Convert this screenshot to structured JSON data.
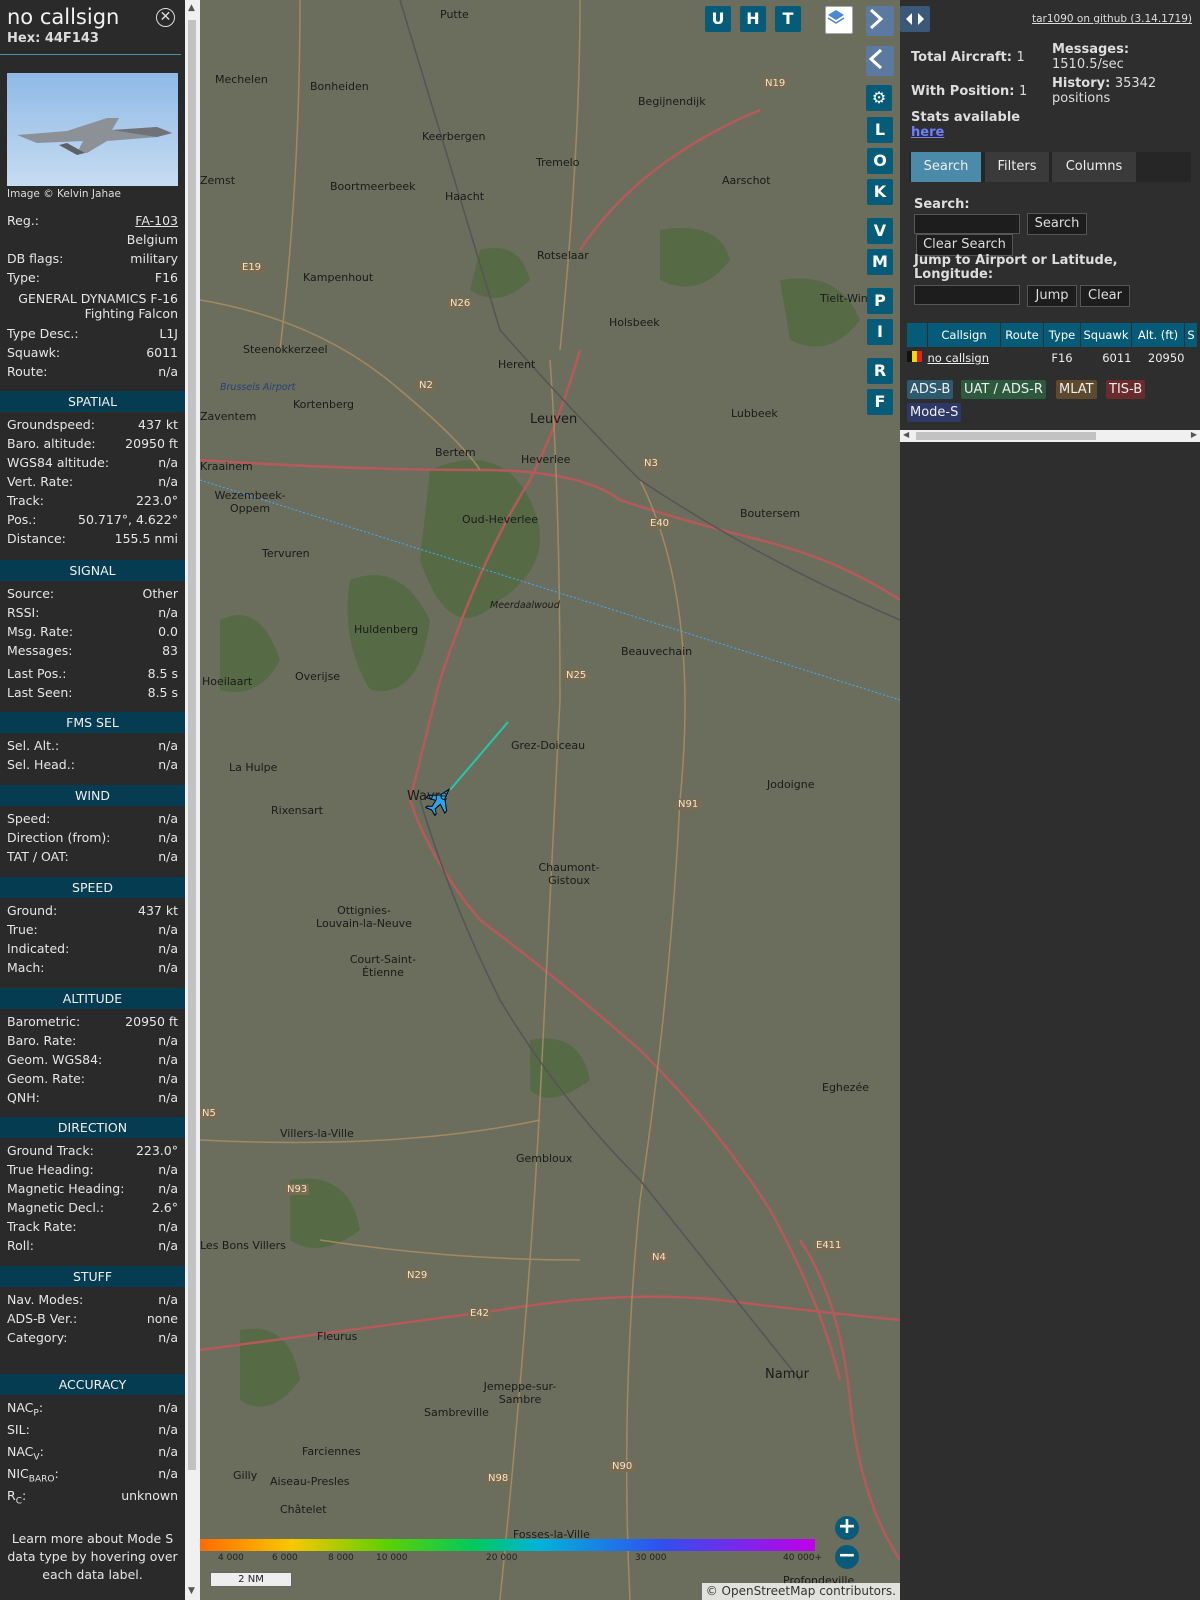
{
  "info": {
    "callsign": "no callsign",
    "hex_label": "Hex:",
    "hex": "44F143",
    "image_credit": "Image © Kelvin Jahae",
    "reg_label": "Reg.:",
    "reg": "FA-103",
    "country": "Belgium",
    "dbflags_label": "DB flags:",
    "dbflags": "military",
    "type_label": "Type:",
    "type": "F16",
    "type_name_1": "GENERAL DYNAMICS F-16",
    "type_name_2": "Fighting Falcon",
    "typedesc_label": "Type Desc.:",
    "typedesc": "L1J",
    "squawk_label": "Squawk:",
    "squawk": "6011",
    "route_label": "Route:",
    "route": "n/a",
    "spatial_title": "SPATIAL",
    "spatial": [
      {
        "k": "Groundspeed:",
        "v": "437 kt"
      },
      {
        "k": "Baro. altitude:",
        "v": "20950 ft"
      },
      {
        "k": "WGS84 altitude:",
        "v": "n/a"
      },
      {
        "k": "Vert. Rate:",
        "v": "n/a"
      },
      {
        "k": "Track:",
        "v": "223.0°"
      },
      {
        "k": "Pos.:",
        "v": "50.717°, 4.622°"
      },
      {
        "k": "Distance:",
        "v": "155.5 nmi"
      }
    ],
    "signal_title": "SIGNAL",
    "signal": [
      {
        "k": "Source:",
        "v": "Other"
      },
      {
        "k": "RSSI:",
        "v": "n/a"
      },
      {
        "k": "Msg. Rate:",
        "v": "0.0"
      },
      {
        "k": "Messages:",
        "v": "83"
      },
      {
        "k": "Last Pos.:",
        "v": "8.5 s"
      },
      {
        "k": "Last Seen:",
        "v": "8.5 s"
      }
    ],
    "fms_title": "FMS SEL",
    "fms": [
      {
        "k": "Sel. Alt.:",
        "v": "n/a"
      },
      {
        "k": "Sel. Head.:",
        "v": "n/a"
      }
    ],
    "wind_title": "WIND",
    "wind": [
      {
        "k": "Speed:",
        "v": "n/a"
      },
      {
        "k": "Direction (from):",
        "v": "n/a"
      },
      {
        "k": "TAT / OAT:",
        "v": "n/a"
      }
    ],
    "speed_title": "SPEED",
    "speed": [
      {
        "k": "Ground:",
        "v": "437 kt"
      },
      {
        "k": "True:",
        "v": "n/a"
      },
      {
        "k": "Indicated:",
        "v": "n/a"
      },
      {
        "k": "Mach:",
        "v": "n/a"
      }
    ],
    "altitude_title": "ALTITUDE",
    "altitude": [
      {
        "k": "Barometric:",
        "v": "20950 ft"
      },
      {
        "k": "Baro. Rate:",
        "v": "n/a"
      },
      {
        "k": "Geom. WGS84:",
        "v": "n/a"
      },
      {
        "k": "Geom. Rate:",
        "v": "n/a"
      },
      {
        "k": "QNH:",
        "v": "n/a"
      }
    ],
    "direction_title": "DIRECTION",
    "direction": [
      {
        "k": "Ground Track:",
        "v": "223.0°"
      },
      {
        "k": "True Heading:",
        "v": "n/a"
      },
      {
        "k": "Magnetic Heading:",
        "v": "n/a"
      },
      {
        "k": "Magnetic Decl.:",
        "v": "2.6°"
      },
      {
        "k": "Track Rate:",
        "v": "n/a"
      },
      {
        "k": "Roll:",
        "v": "n/a"
      }
    ],
    "stuff_title": "STUFF",
    "stuff": [
      {
        "k": "Nav. Modes:",
        "v": "n/a"
      },
      {
        "k": "ADS-B Ver.:",
        "v": "none"
      },
      {
        "k": "Category:",
        "v": "n/a"
      }
    ],
    "accuracy_title": "ACCURACY",
    "accuracy": [
      {
        "k": "NAC",
        "sub": "P",
        "v": "n/a"
      },
      {
        "k": "SIL:",
        "sub": "",
        "v": "n/a"
      },
      {
        "k": "NAC",
        "sub": "V",
        "v": "n/a"
      },
      {
        "k": "NIC",
        "sub": "BARO",
        "v": "n/a"
      },
      {
        "k": "R",
        "sub": "C",
        "v": "unknown"
      }
    ],
    "learn_more": "Learn more about Mode S data type by hovering over each data label."
  },
  "map": {
    "buttons": [
      "U",
      "H",
      "T"
    ],
    "side_buttons": [
      "L",
      "O",
      "K",
      "V",
      "M",
      "P",
      "I",
      "R",
      "F"
    ],
    "places": [
      {
        "t": "Putte"
      },
      {
        "t": "Mechelen"
      },
      {
        "t": "Bonheiden"
      },
      {
        "t": "Begijnendijk"
      },
      {
        "t": "Keerbergen"
      },
      {
        "t": "Tremelo"
      },
      {
        "t": "Zemst"
      },
      {
        "t": "Boortmeerbeek"
      },
      {
        "t": "Haacht"
      },
      {
        "t": "Aarschot"
      },
      {
        "t": "Rotselaar"
      },
      {
        "t": "Kampenhout"
      },
      {
        "t": "Holsbeek"
      },
      {
        "t": "Steenokkerzeel"
      },
      {
        "t": "Herent"
      },
      {
        "t": "Brussels Airport"
      },
      {
        "t": "Kortenberg"
      },
      {
        "t": "Zaventem"
      },
      {
        "t": "Leuven"
      },
      {
        "t": "Lubbeek"
      },
      {
        "t": "Bertem"
      },
      {
        "t": "Heverlee"
      },
      {
        "t": "Kraainem"
      },
      {
        "t": "Wezembeek-Oppem"
      },
      {
        "t": "Oud-Heverlee"
      },
      {
        "t": "Boutersem"
      },
      {
        "t": "Tervuren"
      },
      {
        "t": "Meerdaalwoud"
      },
      {
        "t": "Huldenberg"
      },
      {
        "t": "Beauvechain"
      },
      {
        "t": "Hoeilaart"
      },
      {
        "t": "Overijse"
      },
      {
        "t": "Grez-Doiceau"
      },
      {
        "t": "La Hulpe"
      },
      {
        "t": "Jodoigne"
      },
      {
        "t": "Rixensart"
      },
      {
        "t": "Wavre"
      },
      {
        "t": "Chaumont-Gistoux"
      },
      {
        "t": "Ottignies-Louvain-la-Neuve"
      },
      {
        "t": "Court-Saint-Étienne"
      },
      {
        "t": "Eghezée"
      },
      {
        "t": "Villers-la-Ville"
      },
      {
        "t": "Gembloux"
      },
      {
        "t": "Les Bons Villers"
      },
      {
        "t": "Fleurus"
      },
      {
        "t": "Namur"
      },
      {
        "t": "Jemeppe-sur-Sambre"
      },
      {
        "t": "Sambreville"
      },
      {
        "t": "Farciennes"
      },
      {
        "t": "Gilly"
      },
      {
        "t": "Aiseau-Presles"
      },
      {
        "t": "Châtelet"
      },
      {
        "t": "Fosses-la-Ville"
      },
      {
        "t": "Profondeville"
      },
      {
        "t": "Tielt-Winge"
      }
    ],
    "roads": [
      "N19",
      "E19",
      "N26",
      "N2",
      "N3",
      "E40",
      "N25",
      "N91",
      "N93",
      "N4",
      "N29",
      "E42",
      "E411",
      "N98",
      "N90",
      "N5"
    ],
    "scale": "2 NM",
    "altitude_legend": [
      "4 000",
      "6 000",
      "8 000",
      "10 000",
      "20 000",
      "30 000",
      "40 000+"
    ],
    "attribution": "© OpenStreetMap contributors.",
    "zoom_in": "+",
    "zoom_out": "−"
  },
  "sidebar": {
    "github": "tar1090 on github (3.14.1719)",
    "total_label": "Total Aircraft:",
    "total": "1",
    "withpos_label": "With Position:",
    "withpos": "1",
    "messages_label": "Messages:",
    "messages": "1510.5/sec",
    "history_label": "History:",
    "history": "35342 positions",
    "stats_label": "Stats available",
    "stats_link": "here",
    "tabs": [
      "Search",
      "Filters",
      "Columns"
    ],
    "search_label": "Search:",
    "search_btn": "Search",
    "clear_search_btn": "Clear Search",
    "jump_label": "Jump to Airport or Latitude, Longitude:",
    "jump_btn": "Jump",
    "clear_btn": "Clear",
    "table_headers": [
      "Callsign",
      "Route",
      "Type",
      "Squawk",
      "Alt. (ft)",
      "S"
    ],
    "table_row": {
      "callsign": "no callsign",
      "route": "",
      "type": "F16",
      "squawk": "6011",
      "alt": "20950"
    },
    "badges": [
      "ADS-B",
      "UAT / ADS-R",
      "MLAT",
      "TIS-B",
      "Mode-S"
    ]
  }
}
